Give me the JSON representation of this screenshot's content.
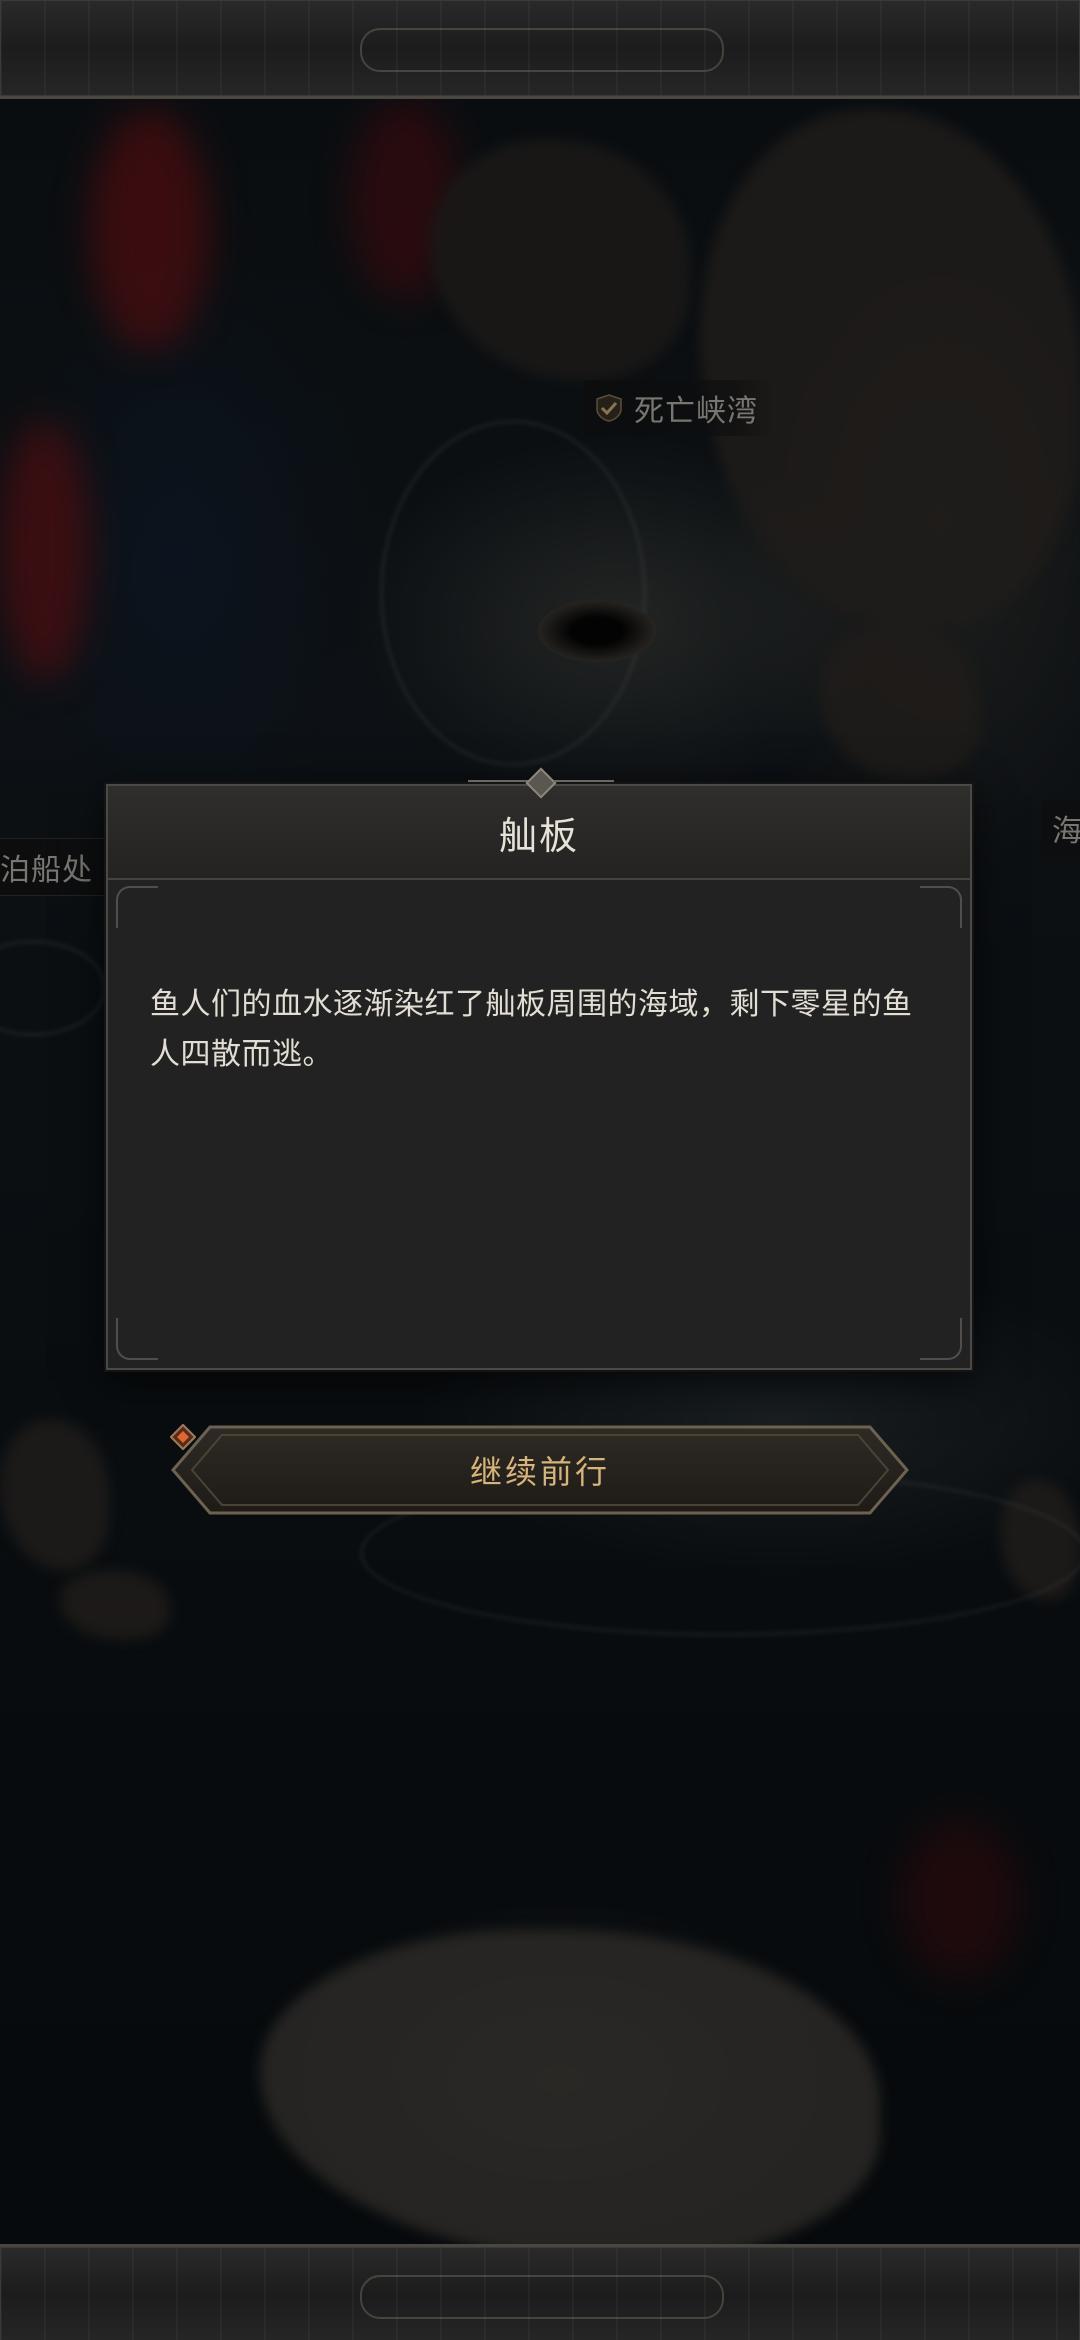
{
  "map": {
    "labels": {
      "death_bay": "死亡峡湾",
      "dock": "泊船处",
      "sea": "海"
    }
  },
  "dialog": {
    "title": "舢板",
    "body": "鱼人们的血水逐渐染红了舢板周围的海域，剩下零星的鱼人四散而逃。"
  },
  "continue_button": {
    "label": "继续前行"
  },
  "colors": {
    "accent_gold": "#d7b47a",
    "button_gem": "#e2672f",
    "dialog_bg": "#222222"
  }
}
